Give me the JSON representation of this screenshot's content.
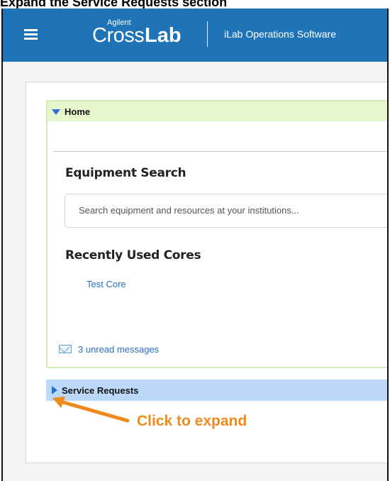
{
  "caption": "Expand the Service Requests section",
  "topbar": {
    "menu_icon": "hamburger-menu-icon",
    "logo_small": "Agilent",
    "logo_part1": "Cross",
    "logo_part2": "Lab",
    "product": "iLab Operations Software",
    "background": "#1f73b7"
  },
  "home": {
    "title": "Home",
    "equipment_search": {
      "title": "Equipment Search",
      "placeholder": "Search equipment and resources at your institutions..."
    },
    "recent": {
      "title": "Recently Used Cores",
      "items": [
        "Test Core"
      ]
    },
    "messages": {
      "icon": "envelope-icon",
      "text": "3 unread messages"
    }
  },
  "service_requests": {
    "title": "Service Requests"
  },
  "annotation": {
    "text": "Click to expand",
    "color": "#f08a1c"
  }
}
